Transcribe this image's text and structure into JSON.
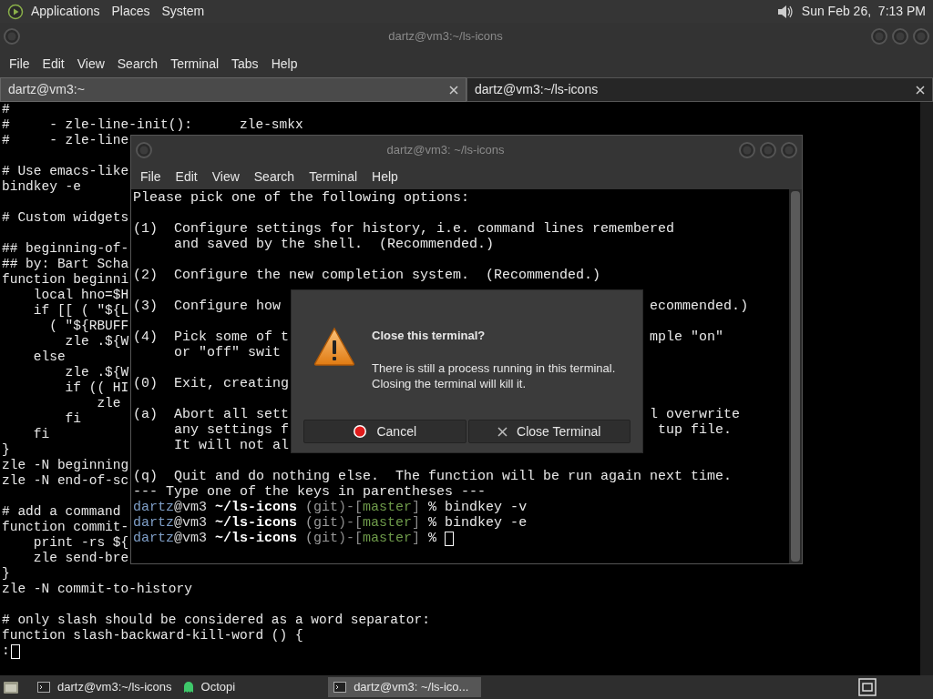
{
  "top_panel": {
    "menus": [
      "Applications",
      "Places",
      "System"
    ],
    "clock": "Sun Feb 26,  7:13 PM"
  },
  "terminal_window": {
    "title": "dartz@vm3:~/ls-icons",
    "menus": [
      "File",
      "Edit",
      "View",
      "Search",
      "Terminal",
      "Tabs",
      "Help"
    ],
    "tabs": [
      {
        "label": "dartz@vm3:~",
        "selected": false
      },
      {
        "label": "dartz@vm3:~/ls-icons",
        "selected": true
      }
    ],
    "blocks": [
      [
        "#",
        "#     - zle-line-init():      zle-smkx",
        "#     - zle-line"
      ],
      [
        "# Use emacs-like",
        "bindkey -e"
      ],
      [
        "# Custom widgets"
      ],
      [
        "## beginning-of-",
        "## by: Bart Scha",
        "function beginni",
        "    local hno=$H",
        "    if [[ ( \"${L",
        "      ( \"${RBUFF",
        "        zle .${W",
        "    else",
        "        zle .${W",
        "        if (( HI",
        "            zle",
        "        fi",
        "    fi",
        "}",
        "zle -N beginning",
        "zle -N end-of-sc"
      ],
      [
        "# add a command",
        "function commit-",
        "    print -rs ${",
        "    zle send-bre",
        "}",
        "zle -N commit-to-history"
      ],
      [
        "# only slash should be considered as a word separator:",
        "function slash-backward-kill-word () {",
        ":"
      ]
    ],
    "cursor": true
  },
  "inner_window": {
    "title": "dartz@vm3: ~/ls-icons",
    "menus": [
      "File",
      "Edit",
      "View",
      "Search",
      "Terminal",
      "Help"
    ],
    "blocks": [
      [
        "Please pick one of the following options:"
      ],
      [
        "(1)  Configure settings for history, i.e. command lines remembered",
        "     and saved by the shell.  (Recommended.)"
      ],
      [
        "(2)  Configure the new completion system.  (Recommended.)"
      ],
      [
        "(3)  Configure how                                             ecommended.)"
      ],
      [
        "(4)  Pick some of t                                            mple \"on\"",
        "     or \"off\" swit"
      ],
      [
        "(0)  Exit, creating"
      ],
      [
        "(a)  Abort all sett                                            l overwrite",
        "     any settings f                                             tup file.",
        "     It will not al"
      ],
      [
        "(q)  Quit and do nothing else.  The function will be run again next time.",
        "--- Type one of the keys in parentheses ---"
      ]
    ],
    "prompts": [
      {
        "segments": [
          {
            "text": "dartz",
            "color": "#7f9fc8",
            "bold": false
          },
          {
            "text": "@vm3 ",
            "color": "#d8d8d8",
            "bold": false
          },
          {
            "text": "~/ls-icons",
            "color": "#ffffff",
            "bold": true
          },
          {
            "text": " (git",
            "color": "#9a9a9a",
            "bold": false
          },
          {
            "text": ")-[",
            "color": "#8a8a8a",
            "bold": false
          },
          {
            "text": "master",
            "color": "#6e9a4a",
            "bold": false
          },
          {
            "text": "] ",
            "color": "#8a8a8a",
            "bold": false
          },
          {
            "text": "% bindkey -v",
            "color": "#e8e8e8",
            "bold": false
          }
        ]
      },
      {
        "segments": [
          {
            "text": "dartz",
            "color": "#7f9fc8",
            "bold": false
          },
          {
            "text": "@vm3 ",
            "color": "#d8d8d8",
            "bold": false
          },
          {
            "text": "~/ls-icons",
            "color": "#ffffff",
            "bold": true
          },
          {
            "text": " (git",
            "color": "#9a9a9a",
            "bold": false
          },
          {
            "text": ")-[",
            "color": "#8a8a8a",
            "bold": false
          },
          {
            "text": "master",
            "color": "#6e9a4a",
            "bold": false
          },
          {
            "text": "] ",
            "color": "#8a8a8a",
            "bold": false
          },
          {
            "text": "% bindkey -e",
            "color": "#e8e8e8",
            "bold": false
          }
        ]
      },
      {
        "segments": [
          {
            "text": "dartz",
            "color": "#7f9fc8",
            "bold": false
          },
          {
            "text": "@vm3 ",
            "color": "#d8d8d8",
            "bold": false
          },
          {
            "text": "~/ls-icons",
            "color": "#ffffff",
            "bold": true
          },
          {
            "text": " (git",
            "color": "#9a9a9a",
            "bold": false
          },
          {
            "text": ")-[",
            "color": "#8a8a8a",
            "bold": false
          },
          {
            "text": "master",
            "color": "#6e9a4a",
            "bold": false
          },
          {
            "text": "] ",
            "color": "#8a8a8a",
            "bold": false
          },
          {
            "text": "%",
            "color": "#e8e8e8",
            "bold": false
          }
        ]
      }
    ],
    "cursor": true
  },
  "dialog": {
    "title": "Close this terminal?",
    "message": [
      "There is still a process running in this terminal.",
      "Closing the terminal will kill it."
    ],
    "buttons": [
      {
        "kind": "cancel",
        "label": "Cancel"
      },
      {
        "kind": "confirm",
        "label": "Close Terminal"
      }
    ]
  },
  "taskbar": {
    "items": [
      {
        "kind": "terminal",
        "label": "dartz@vm3:~/ls-icons",
        "selected": false
      },
      {
        "kind": "ghost",
        "label": "Octopi",
        "selected": false
      },
      {
        "kind": "terminal",
        "label": "dartz@vm3: ~/ls-ico...",
        "selected": true
      }
    ]
  }
}
